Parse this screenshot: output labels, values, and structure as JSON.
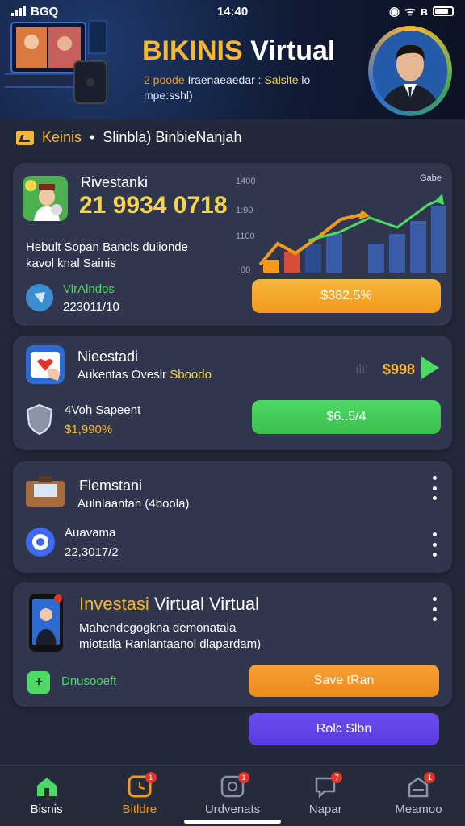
{
  "status_bar": {
    "carrier": "BGQ",
    "time": "14:40"
  },
  "banner": {
    "title_accent": "BIKINIS",
    "title_rest": "Virtual",
    "subtitle_prefix": "2 poode",
    "subtitle_mid": "Iraenaeaedar :",
    "subtitle_hl": "Salslte",
    "subtitle_end": "lo",
    "subtitle_line2": "mpe:sshl)"
  },
  "section": {
    "accent": "Keinis",
    "separator": "•",
    "rest": "Slinbla) BinbieNanjah"
  },
  "card1": {
    "title": "Rivestanki",
    "amount": "21 9934 0718",
    "desc_line1": "Hebult Sopan Bancls dulionde",
    "desc_line2": "kavol knal Sainis",
    "stat_label": "VirAlndos",
    "stat_value": "223011/10",
    "button": "$382.5%",
    "chart_axis_top": "1400",
    "chart_axis_mid": "1:90",
    "chart_axis_low": "1100",
    "chart_axis_zero": "00",
    "chart_corner": "Gabe"
  },
  "card2": {
    "title": "Nieestadi",
    "subtitle": "Aukentas Oveslr",
    "subtitle_hl": "Sboodo",
    "right_value": "$998",
    "stat_label": "4Voh Sapeent",
    "stat_value": "$1,990%",
    "button": "$6..5/4"
  },
  "card3": {
    "title": "Flemstani",
    "subtitle": "Aulnlaantan (4boola)",
    "stat_label": "Auavama",
    "stat_value": "22,3017/2"
  },
  "card4": {
    "title_accent": "Investasi",
    "title_rest": "Virtual Virtual",
    "desc_line1": "Mahendegogkna demonatala",
    "desc_line2": "miotatla Ranlantaanol dlapardam)",
    "tag": "Dnusooeft",
    "button_primary": "Save tRan",
    "button_secondary": "Rolc Slbn"
  },
  "nav": {
    "items": [
      {
        "label": "Bisnis",
        "badge": ""
      },
      {
        "label": "Bitldre",
        "badge": "1"
      },
      {
        "label": "Urdvenats",
        "badge": "1"
      },
      {
        "label": "Napar",
        "badge": "7"
      },
      {
        "label": "Meamoo",
        "badge": "1"
      }
    ]
  },
  "colors": {
    "accent_orange": "#f7b733",
    "accent_green": "#4cd964",
    "accent_purple": "#5a3be0",
    "card_bg": "#2f364d",
    "page_bg": "#23283a"
  }
}
